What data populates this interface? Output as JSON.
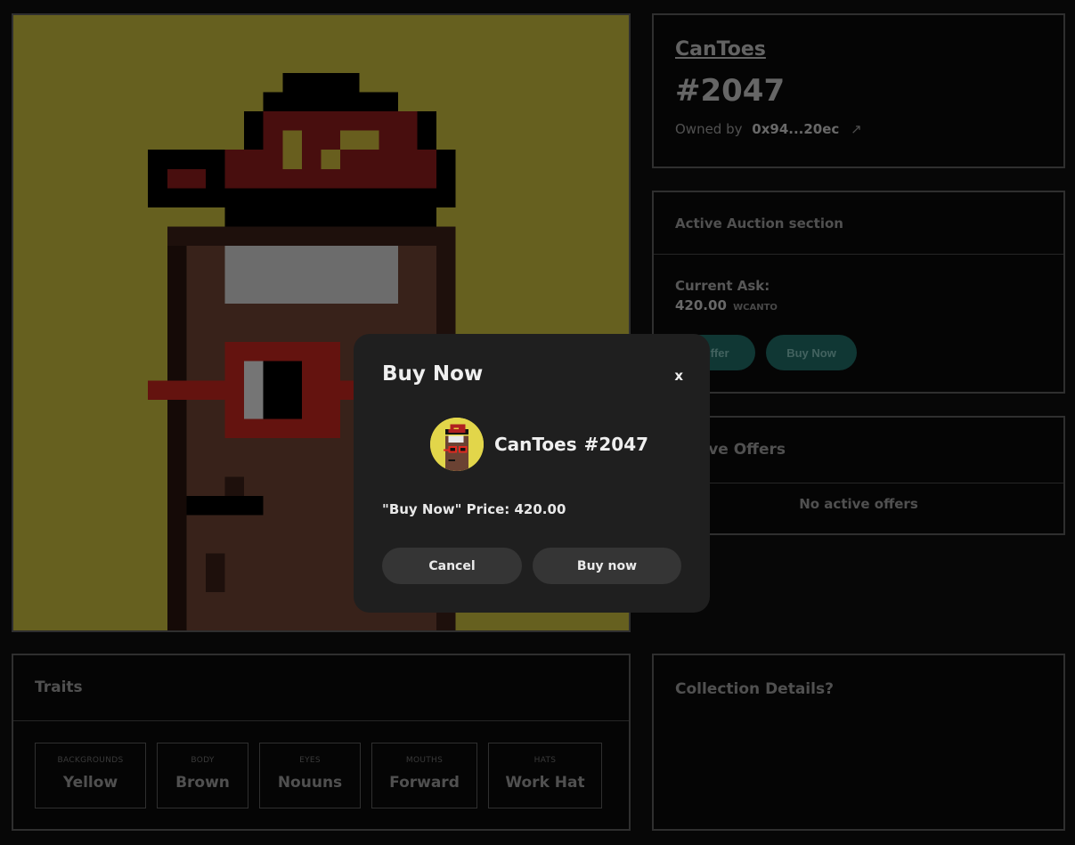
{
  "nft": {
    "collection": "CanToes",
    "token_id": "#2047",
    "owned_by_label": "Owned by",
    "owner": "0x94...20ec",
    "owner_link_icon": "external-link-icon"
  },
  "auction": {
    "heading": "Active Auction section",
    "current_ask_label": "Current Ask:",
    "current_ask_value": "420.00",
    "currency": "WCANTO",
    "offer_button": "Offer",
    "buy_button": "Buy Now"
  },
  "offers": {
    "heading": "Active Offers",
    "empty_text": "No active offers"
  },
  "traits": {
    "heading": "Traits",
    "items": [
      {
        "type": "BACKGROUNDS",
        "value": "Yellow"
      },
      {
        "type": "BODY",
        "value": "Brown"
      },
      {
        "type": "EYES",
        "value": "Nouuns"
      },
      {
        "type": "MOUTHS",
        "value": "Forward"
      },
      {
        "type": "HATS",
        "value": "Work Hat"
      }
    ]
  },
  "collection_details": {
    "heading": "Collection Details?"
  },
  "modal": {
    "title": "Buy Now",
    "close_symbol": "x",
    "item_collection": "CanToes",
    "item_token": "#2047",
    "price_line": "\"Buy Now\" Price: 420.00",
    "cancel_button": "Cancel",
    "confirm_button": "Buy now"
  },
  "colors": {
    "background": "#0e0e0e",
    "art_background": "#c4b83c",
    "accent_teal": "#1f6a65",
    "modal_background": "#1f1f1f"
  }
}
